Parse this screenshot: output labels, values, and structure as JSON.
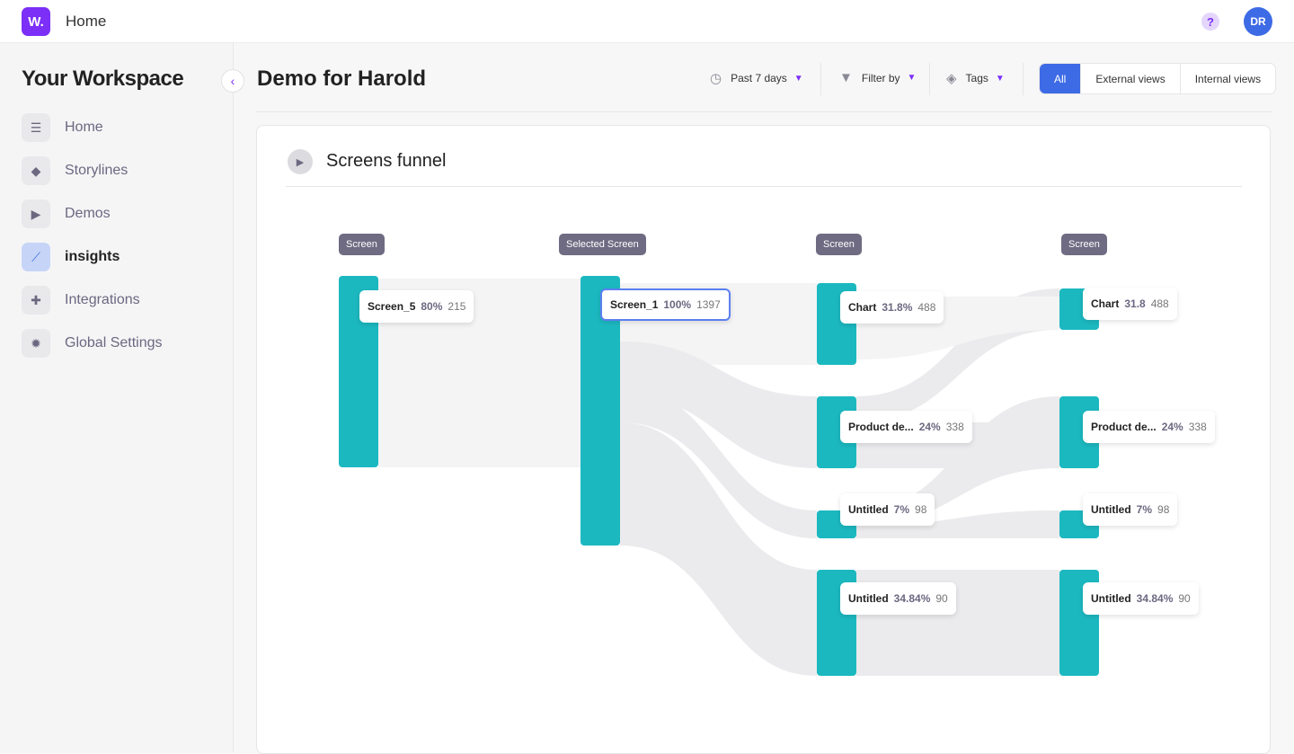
{
  "topbar": {
    "logo": "W.",
    "title": "Home",
    "help": "?",
    "avatar": "DR"
  },
  "sidebar": {
    "title": "Your Workspace",
    "items": [
      {
        "label": "Home",
        "icon": "dashboard-icon"
      },
      {
        "label": "Storylines",
        "icon": "layers-icon"
      },
      {
        "label": "Demos",
        "icon": "play-icon"
      },
      {
        "label": "insights",
        "icon": "chart-line-icon",
        "active": true
      },
      {
        "label": "Integrations",
        "icon": "puzzle-icon"
      },
      {
        "label": "Global Settings",
        "icon": "gear-icon"
      }
    ]
  },
  "header": {
    "title": "Demo for Harold",
    "date_filter": "Past 7 days",
    "filter_by": "Filter by",
    "tags": "Tags",
    "views": [
      "All",
      "External views",
      "Internal views"
    ],
    "selected_view": "All"
  },
  "funnel": {
    "title": "Screens funnel",
    "columns": [
      "Screen",
      "Selected Screen",
      "Screen",
      "Screen"
    ],
    "nodes": [
      {
        "col": 0,
        "name": "Screen_5",
        "pct": "80%",
        "count": "215"
      },
      {
        "col": 1,
        "name": "Screen_1",
        "pct": "100%",
        "count": "1397",
        "selected": true
      },
      {
        "col": 2,
        "name": "Chart",
        "pct": "31.8%",
        "count": "488"
      },
      {
        "col": 2,
        "name": "Product de...",
        "pct": "24%",
        "count": "338"
      },
      {
        "col": 2,
        "name": "Untitled",
        "pct": "7%",
        "count": "98"
      },
      {
        "col": 2,
        "name": "Untitled",
        "pct": "34.84%",
        "count": "90"
      },
      {
        "col": 3,
        "name": "Chart",
        "pct": "31.8",
        "count": "488"
      },
      {
        "col": 3,
        "name": "Product de...",
        "pct": "24%",
        "count": "338"
      },
      {
        "col": 3,
        "name": "Untitled",
        "pct": "7%",
        "count": "98"
      },
      {
        "col": 3,
        "name": "Untitled",
        "pct": "34.84%",
        "count": "90"
      }
    ],
    "colors": {
      "node": "#1cb8c0",
      "link": "#ebebed",
      "link_light": "#f4f4f5"
    }
  }
}
